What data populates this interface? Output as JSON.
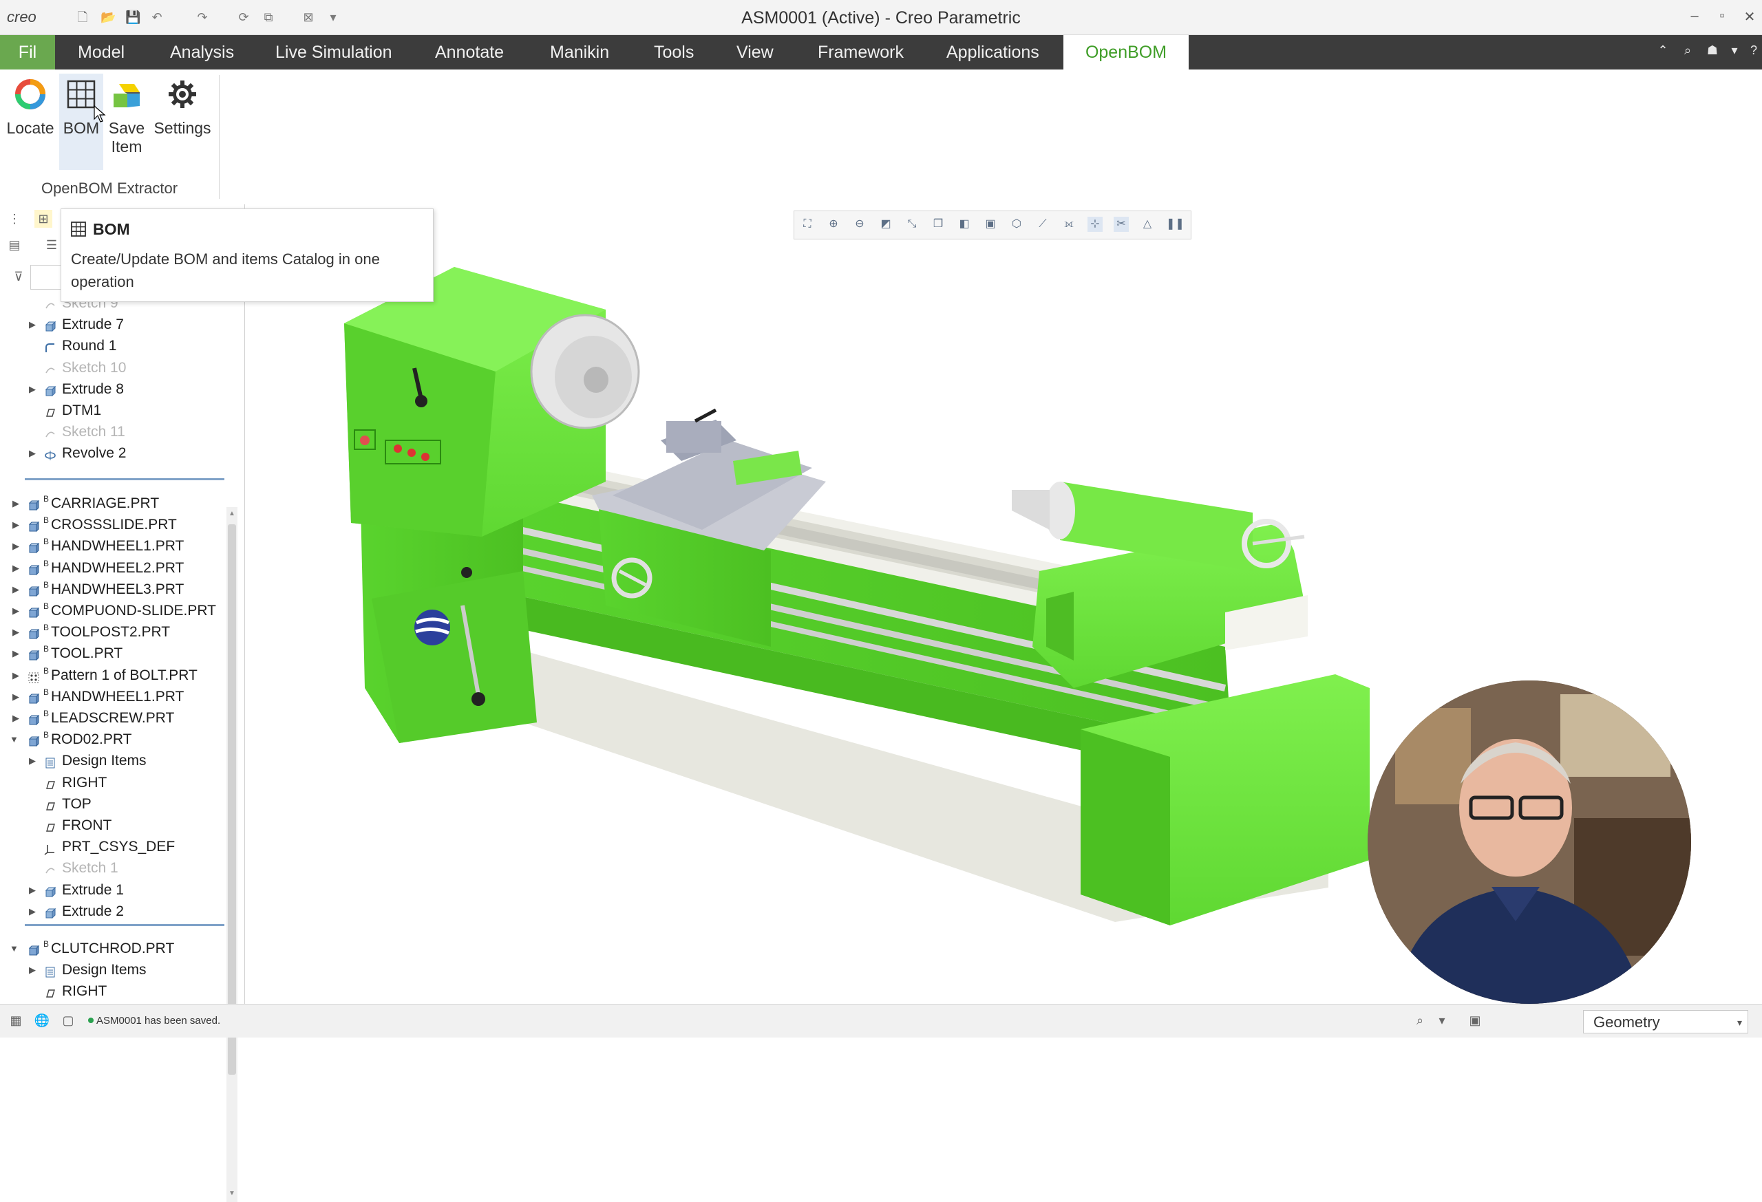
{
  "titlebar": {
    "logo": "creo",
    "title": "ASM0001 (Active) - Creo Parametric"
  },
  "menu": {
    "file": "Fil",
    "items": [
      "Model",
      "Analysis",
      "Live Simulation",
      "Annotate",
      "Manikin",
      "Tools",
      "View",
      "Framework",
      "Applications"
    ],
    "active": "OpenBOM"
  },
  "ribbon": {
    "buttons": [
      {
        "label": "Locate",
        "icon": "locate-icon"
      },
      {
        "label": "BOM",
        "icon": "grid-icon"
      },
      {
        "label": "Save",
        "label2": "Item",
        "icon": "save-item-icon"
      },
      {
        "label": "Settings",
        "icon": "gear-icon"
      }
    ],
    "group_label": "OpenBOM Extractor"
  },
  "tooltip": {
    "title": "BOM",
    "description": "Create/Update BOM and items Catalog in one operation"
  },
  "tree": {
    "upper": [
      {
        "label": "Sketch 9",
        "kind": "sketch",
        "dim": true,
        "expand": false
      },
      {
        "label": "Extrude 7",
        "kind": "extrude",
        "dim": false,
        "expand": true
      },
      {
        "label": "Round 1",
        "kind": "round",
        "dim": false,
        "expand": false
      },
      {
        "label": "Sketch 10",
        "kind": "sketch",
        "dim": true,
        "expand": false
      },
      {
        "label": "Extrude 8",
        "kind": "extrude",
        "dim": false,
        "expand": true
      },
      {
        "label": "DTM1",
        "kind": "plane",
        "dim": false,
        "expand": false
      },
      {
        "label": "Sketch 11",
        "kind": "sketch",
        "dim": true,
        "expand": false
      },
      {
        "label": "Revolve 2",
        "kind": "revolve",
        "dim": false,
        "expand": true
      }
    ],
    "parts": [
      {
        "label": "CARRIAGE.PRT",
        "kind": "part"
      },
      {
        "label": "CROSSSLIDE.PRT",
        "kind": "part"
      },
      {
        "label": "HANDWHEEL1.PRT",
        "kind": "part"
      },
      {
        "label": "HANDWHEEL2.PRT",
        "kind": "part"
      },
      {
        "label": "HANDWHEEL3.PRT",
        "kind": "part"
      },
      {
        "label": "COMPUOND-SLIDE.PRT",
        "kind": "part"
      },
      {
        "label": "TOOLPOST2.PRT",
        "kind": "part"
      },
      {
        "label": "TOOL.PRT",
        "kind": "part"
      },
      {
        "label": "Pattern 1 of BOLT.PRT",
        "kind": "pattern"
      },
      {
        "label": "HANDWHEEL1.PRT",
        "kind": "part"
      },
      {
        "label": "LEADSCREW.PRT",
        "kind": "part"
      }
    ],
    "rod02": {
      "label": "ROD02.PRT"
    },
    "rod02_children": [
      {
        "label": "Design Items",
        "kind": "design",
        "dim": false,
        "expand": true
      },
      {
        "label": "RIGHT",
        "kind": "plane",
        "dim": false,
        "expand": false
      },
      {
        "label": "TOP",
        "kind": "plane",
        "dim": false,
        "expand": false
      },
      {
        "label": "FRONT",
        "kind": "plane",
        "dim": false,
        "expand": false
      },
      {
        "label": "PRT_CSYS_DEF",
        "kind": "csys",
        "dim": false,
        "expand": false
      },
      {
        "label": "Sketch 1",
        "kind": "sketch",
        "dim": true,
        "expand": false
      },
      {
        "label": "Extrude 1",
        "kind": "extrude",
        "dim": false,
        "expand": true
      },
      {
        "label": "Extrude 2",
        "kind": "extrude",
        "dim": false,
        "expand": true
      }
    ],
    "clutchrod": {
      "label": "CLUTCHROD.PRT"
    },
    "clutch_children": [
      {
        "label": "Design Items",
        "kind": "design",
        "dim": false,
        "expand": true
      },
      {
        "label": "RIGHT",
        "kind": "plane",
        "dim": false,
        "expand": false
      }
    ]
  },
  "status": {
    "message": "ASM0001 has been saved.",
    "filter": "Geometry"
  },
  "colors": {
    "lathe_green": "#6ae23c",
    "menubar": "#3c3c3c",
    "active_tab_text": "#3f9d27"
  }
}
